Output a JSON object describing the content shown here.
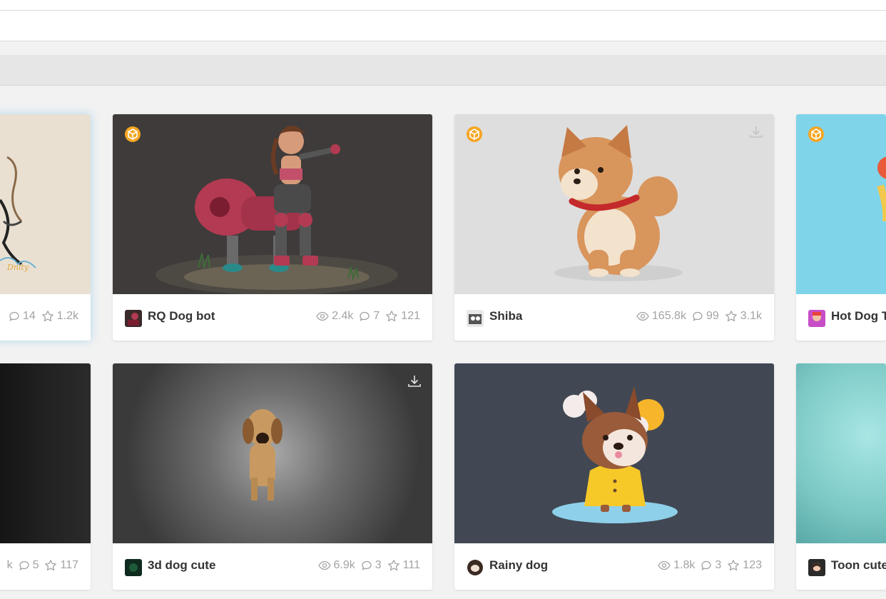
{
  "colors": {
    "accent_3d_badge": "#f5a623",
    "stat_grey": "#a3a3a3"
  },
  "cards": [
    {
      "title": "",
      "views": "",
      "comments": "14",
      "likes": "1.2k"
    },
    {
      "title": "RQ Dog bot",
      "views": "2.4k",
      "comments": "7",
      "likes": "121"
    },
    {
      "title": "Shiba",
      "views": "165.8k",
      "comments": "99",
      "likes": "3.1k"
    },
    {
      "title": "Hot Dog T",
      "views": "",
      "comments": "",
      "likes": ""
    },
    {
      "title": "",
      "views": "k",
      "comments": "5",
      "likes": "117"
    },
    {
      "title": "3d dog cute",
      "views": "6.9k",
      "comments": "3",
      "likes": "111"
    },
    {
      "title": "Rainy dog",
      "views": "1.8k",
      "comments": "3",
      "likes": "123"
    },
    {
      "title": "Toon cute",
      "views": "",
      "comments": "",
      "likes": ""
    }
  ],
  "icons": {
    "views": "eye-icon",
    "comments": "comment-icon",
    "likes": "star-icon",
    "download": "download-icon",
    "badge": "3d-model-badge-icon"
  }
}
